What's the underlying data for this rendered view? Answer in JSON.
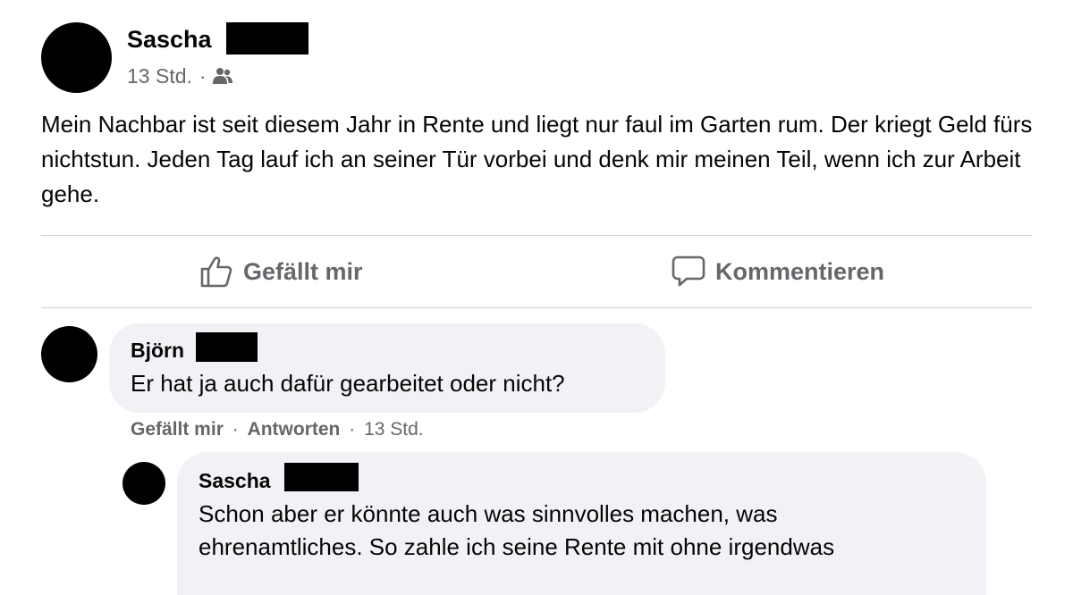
{
  "post": {
    "author": "Sascha",
    "time": "13 Std.",
    "separator": "·",
    "audience_icon": "friends-icon",
    "text": "Mein Nachbar ist seit diesem Jahr in Rente und liegt nur faul im Garten rum. Der kriegt Geld fürs nichtstun. Jeden Tag lauf ich an seiner Tür vorbei und denk mir meinen Teil, wenn ich zur Arbeit gehe."
  },
  "actions": {
    "like_label": "Gefällt mir",
    "like_icon": "thumbs-up-icon",
    "comment_label": "Kommentieren",
    "comment_icon": "speech-bubble-icon"
  },
  "comments": [
    {
      "author": "Björn",
      "text": "Er hat ja auch dafür gearbeitet oder nicht?",
      "like_label": "Gefällt mir",
      "reply_label": "Antworten",
      "separator": "·",
      "time": "13 Std."
    }
  ],
  "reply": {
    "author": "Sascha",
    "text_line1": "Schon aber er könnte auch was sinnvolles machen, was",
    "text_line2": "ehrenamtliches. So zahle ich seine Rente mit ohne irgendwas"
  },
  "colors": {
    "secondary_text": "#65676b",
    "bubble": "#f0f2f5",
    "divider": "#ced0d4",
    "redaction": "#000000"
  }
}
